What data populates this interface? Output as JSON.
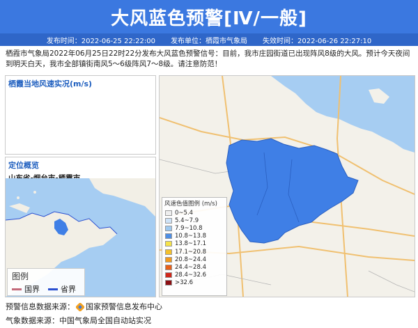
{
  "banner": {
    "title": "大风蓝色预警[Ⅳ/一般]"
  },
  "meta": {
    "publish_time_label": "发布时间：",
    "publish_time": "2022-06-25 22:22:00",
    "publisher_label": "发布单位：",
    "publisher": "栖霞市气象局",
    "expire_label": "失效时间：",
    "expire_time": "2022-06-26 22:27:10"
  },
  "description": "栖霞市气象局2022年06月25日22时22分发布大风蓝色预警信号：目前，我市庄园街道已出现阵风8级的大风。预计今天夜间到明天白天，我市全部镇街南风5～6级阵风7～8级。请注意防范！",
  "wind_panel": {
    "title": "栖霞当地风速实况(m/s)"
  },
  "location_panel": {
    "title": "定位概览",
    "subtitle": "山东省-烟台市-栖霞市"
  },
  "mini_legend": {
    "title": "图例",
    "items": [
      {
        "label": "国界",
        "color": "#c46a7a"
      },
      {
        "label": "省界",
        "color": "#2a4fd0"
      }
    ]
  },
  "wind_legend": {
    "title": "风速色值图例 (m/s)",
    "items": [
      {
        "label": "0~5.4",
        "color": "#eeeeee"
      },
      {
        "label": "5.4~7.9",
        "color": "#cfe3f7"
      },
      {
        "label": "7.9~10.8",
        "color": "#9fc9ef"
      },
      {
        "label": "10.8~13.8",
        "color": "#4e8ee4"
      },
      {
        "label": "13.8~17.1",
        "color": "#f5e24a"
      },
      {
        "label": "17.1~20.8",
        "color": "#f4c02a"
      },
      {
        "label": "20.8~24.4",
        "color": "#f29a1e"
      },
      {
        "label": "24.4~28.4",
        "color": "#e8601a"
      },
      {
        "label": "28.4~32.6",
        "color": "#d0281a"
      },
      {
        "label": ">32.6",
        "color": "#8c0f12"
      }
    ]
  },
  "footer": {
    "warning_source_label": "预警信息数据来源：",
    "warning_source": "国家预警信息发布中心",
    "weather_source_label": "气象数据来源：",
    "weather_source": "中国气象局全国自动站实况"
  },
  "colors": {
    "banner": "#3b78e0",
    "meta_bar": "#2f66c8",
    "warning_area": "#3f7fe6",
    "sea": "#a6cdf2"
  }
}
